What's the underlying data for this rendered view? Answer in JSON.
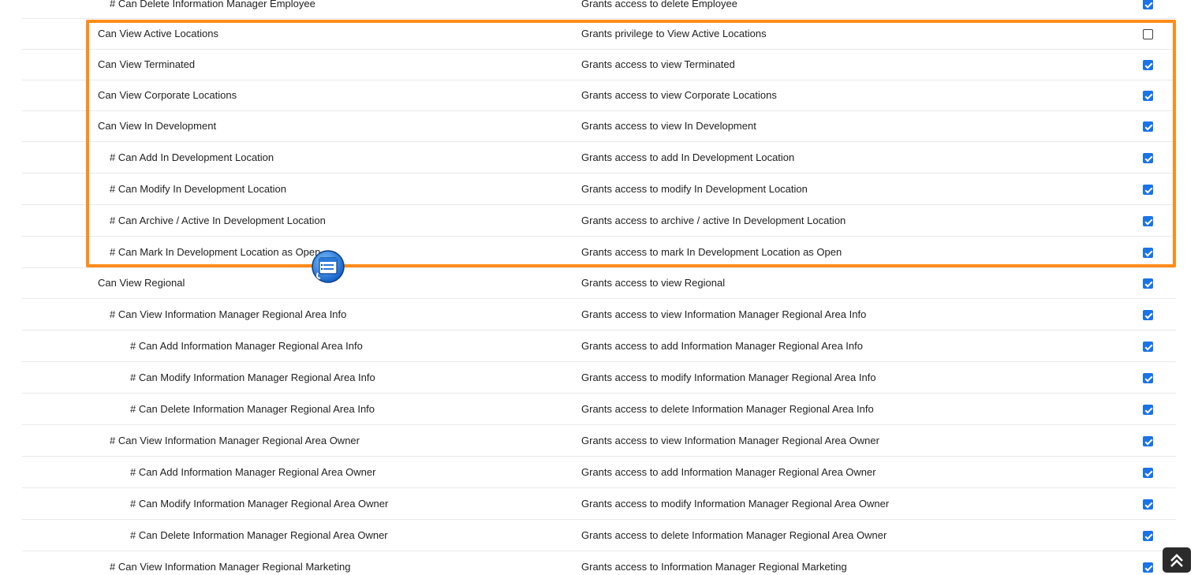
{
  "rows": [
    {
      "permission": "# Can Delete Information Manager Employee",
      "description": "Grants access to delete Employee",
      "level": 1,
      "checked": true
    },
    {
      "permission": "Can View Active Locations",
      "description": "Grants privilege to View Active Locations",
      "level": 0,
      "checked": false
    },
    {
      "permission": "Can View Terminated",
      "description": "Grants access to view Terminated",
      "level": 0,
      "checked": true
    },
    {
      "permission": "Can View Corporate Locations",
      "description": "Grants access to view Corporate Locations",
      "level": 0,
      "checked": true
    },
    {
      "permission": "Can View In Development",
      "description": "Grants access to view In Development",
      "level": 0,
      "checked": true
    },
    {
      "permission": "# Can Add In Development Location",
      "description": "Grants access to add In Development Location",
      "level": 1,
      "checked": true
    },
    {
      "permission": "# Can Modify In Development Location",
      "description": "Grants access to modify In Development Location",
      "level": 1,
      "checked": true
    },
    {
      "permission": "# Can Archive / Active In Development Location",
      "description": "Grants access to archive / active In Development Location",
      "level": 1,
      "checked": true
    },
    {
      "permission": "# Can Mark In Development Location as Open",
      "description": "Grants access to mark In Development Location as Open",
      "level": 1,
      "checked": true
    },
    {
      "permission": "Can View Regional",
      "description": "Grants access to view Regional",
      "level": 0,
      "checked": true
    },
    {
      "permission": "# Can View Information Manager Regional Area Info",
      "description": "Grants access to view Information Manager Regional Area Info",
      "level": 1,
      "checked": true
    },
    {
      "permission": "# Can Add Information Manager Regional Area Info",
      "description": "Grants access to add Information Manager Regional Area Info",
      "level": 2,
      "checked": true
    },
    {
      "permission": "# Can Modify Information Manager Regional Area Info",
      "description": "Grants access to modify Information Manager Regional Area Info",
      "level": 2,
      "checked": true
    },
    {
      "permission": "# Can Delete Information Manager Regional Area Info",
      "description": "Grants access to delete Information Manager Regional Area Info",
      "level": 2,
      "checked": true
    },
    {
      "permission": "# Can View Information Manager Regional Area Owner",
      "description": "Grants access to view Information Manager Regional Area Owner",
      "level": 1,
      "checked": true
    },
    {
      "permission": "# Can Add Information Manager Regional Area Owner",
      "description": "Grants access to add Information Manager Regional Area Owner",
      "level": 2,
      "checked": true
    },
    {
      "permission": "# Can Modify Information Manager Regional Area Owner",
      "description": "Grants access to modify Information Manager Regional Area Owner",
      "level": 2,
      "checked": true
    },
    {
      "permission": "# Can Delete Information Manager Regional Area Owner",
      "description": "Grants access to delete Information Manager Regional Area Owner",
      "level": 2,
      "checked": true
    },
    {
      "permission": "# Can View Information Manager Regional Marketing",
      "description": "Grants access to Information Manager Regional Marketing",
      "level": 1,
      "checked": true
    }
  ],
  "highlight": {
    "color": "#ff8c1a"
  },
  "colors": {
    "checkbox_checked": "#1a73e8",
    "separator": "#e9e9e9"
  },
  "icons": {
    "cursor_widget": "calendar-list-icon",
    "scroll_top": "double-chevron-up-icon"
  }
}
